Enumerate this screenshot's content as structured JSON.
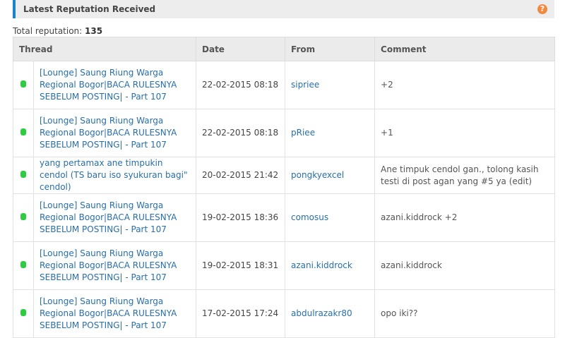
{
  "panel": {
    "title": "Latest Reputation Received",
    "help_icon": "question-circle-icon",
    "accent_color": "#1c84c6"
  },
  "total": {
    "label": "Total reputation:",
    "value": "135"
  },
  "table": {
    "columns": [
      "Thread",
      "Date",
      "From",
      "Comment"
    ],
    "rows": [
      {
        "thread": "[Lounge] Saung Riung Warga Regional Bogor|BACA RULESNYA SEBELUM POSTING| - Part 107",
        "date": "22-02-2015 08:18",
        "from": "sipriee",
        "comment": "+2"
      },
      {
        "thread": "[Lounge] Saung Riung Warga Regional Bogor|BACA RULESNYA SEBELUM POSTING| - Part 107",
        "date": "22-02-2015 08:18",
        "from": "pRiee",
        "comment": "+1"
      },
      {
        "thread": "yang pertamax ane timpukin cendol (TS baru iso syukuran bagi\" cendol)",
        "date": "20-02-2015 21:42",
        "from": "pongkyexcel",
        "comment": "Ane timpuk cendol gan., tolong kasih testi di post agan yang #5 ya (edit)"
      },
      {
        "thread": "[Lounge] Saung Riung Warga Regional Bogor|BACA RULESNYA SEBELUM POSTING| - Part 107",
        "date": "19-02-2015 18:36",
        "from": "comosus",
        "comment": "azani.kiddrock +2"
      },
      {
        "thread": "[Lounge] Saung Riung Warga Regional Bogor|BACA RULESNYA SEBELUM POSTING| - Part 107",
        "date": "19-02-2015 18:31",
        "from": "azani.kiddrock",
        "comment": "azani.kiddrock"
      },
      {
        "thread": "[Lounge] Saung Riung Warga Regional Bogor|BACA RULESNYA SEBELUM POSTING| - Part 107",
        "date": "17-02-2015 17:24",
        "from": "abdulrazakr80",
        "comment": "opo iki??"
      }
    ],
    "positive_color": "#2ecc40"
  }
}
